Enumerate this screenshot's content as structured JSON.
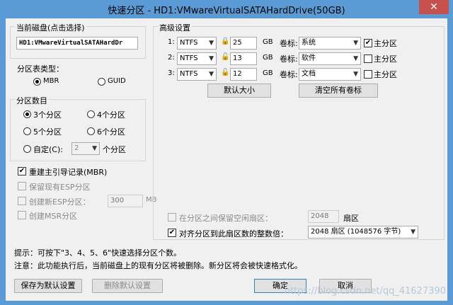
{
  "window": {
    "title": "快速分区 - HD1:VMwareVirtualSATAHardDrive(50GB)",
    "close_glyph": "✕"
  },
  "current_disk": {
    "legend": "当前磁盘(点击选择)",
    "value": "HD1:VMwareVirtualSATAHardDr"
  },
  "partition_table": {
    "label": "分区表类型：",
    "options": [
      "MBR",
      "GUID"
    ],
    "selected": "MBR"
  },
  "partition_count": {
    "legend": "分区数目",
    "options": [
      "3个分区",
      "4个分区",
      "5个分区",
      "6个分区"
    ],
    "selected": "3个分区",
    "custom_label": "自定(C):",
    "custom_value": "2",
    "custom_suffix": "个分区"
  },
  "options": {
    "rebuild_mbr": {
      "label": "重建主引导记录(MBR)",
      "checked": true
    },
    "keep_esp": {
      "label": "保留现有ESP分区",
      "checked": false
    },
    "create_esp": {
      "label": "创建新ESP分区：",
      "value": "300",
      "unit": "MB",
      "checked": false
    },
    "create_msr": {
      "label": "创建MSR分区",
      "checked": false
    }
  },
  "advanced": {
    "legend": "高级设置",
    "rows": [
      {
        "index": "1:",
        "fs": "NTFS",
        "size": "25",
        "unit": "GB",
        "vol_label": "卷标:",
        "volume": "系统",
        "primary_label": "主分区",
        "primary": true
      },
      {
        "index": "2:",
        "fs": "NTFS",
        "size": "13",
        "unit": "GB",
        "vol_label": "卷标:",
        "volume": "软件",
        "primary_label": "主分区",
        "primary": false
      },
      {
        "index": "3:",
        "fs": "NTFS",
        "size": "12",
        "unit": "GB",
        "vol_label": "卷标:",
        "volume": "文档",
        "primary_label": "主分区",
        "primary": false
      }
    ],
    "default_size_button": "默认大小",
    "clear_labels_button": "清空所有卷标"
  },
  "reserve": {
    "label": "在分区之间保留空闲扇区：",
    "value": "2048",
    "unit": "扇区",
    "checked": false
  },
  "align": {
    "label": "对齐分区到此扇区数的整数倍：",
    "value": "2048 扇区 (1048576 字节)",
    "checked": true
  },
  "notes": {
    "hint": "提示：可按下\"3、4、5、6\"快速选择分区个数。",
    "warning": "注意：此功能执行后，当前磁盘上的现有分区将被删除。新分区将会被快速格式化。"
  },
  "buttons": {
    "save_default": "保存为默认设置",
    "delete_default": "删除默认设置",
    "ok": "确定",
    "cancel": "取消"
  },
  "watermark": "https://blog.csdn.net/qq_41627390"
}
